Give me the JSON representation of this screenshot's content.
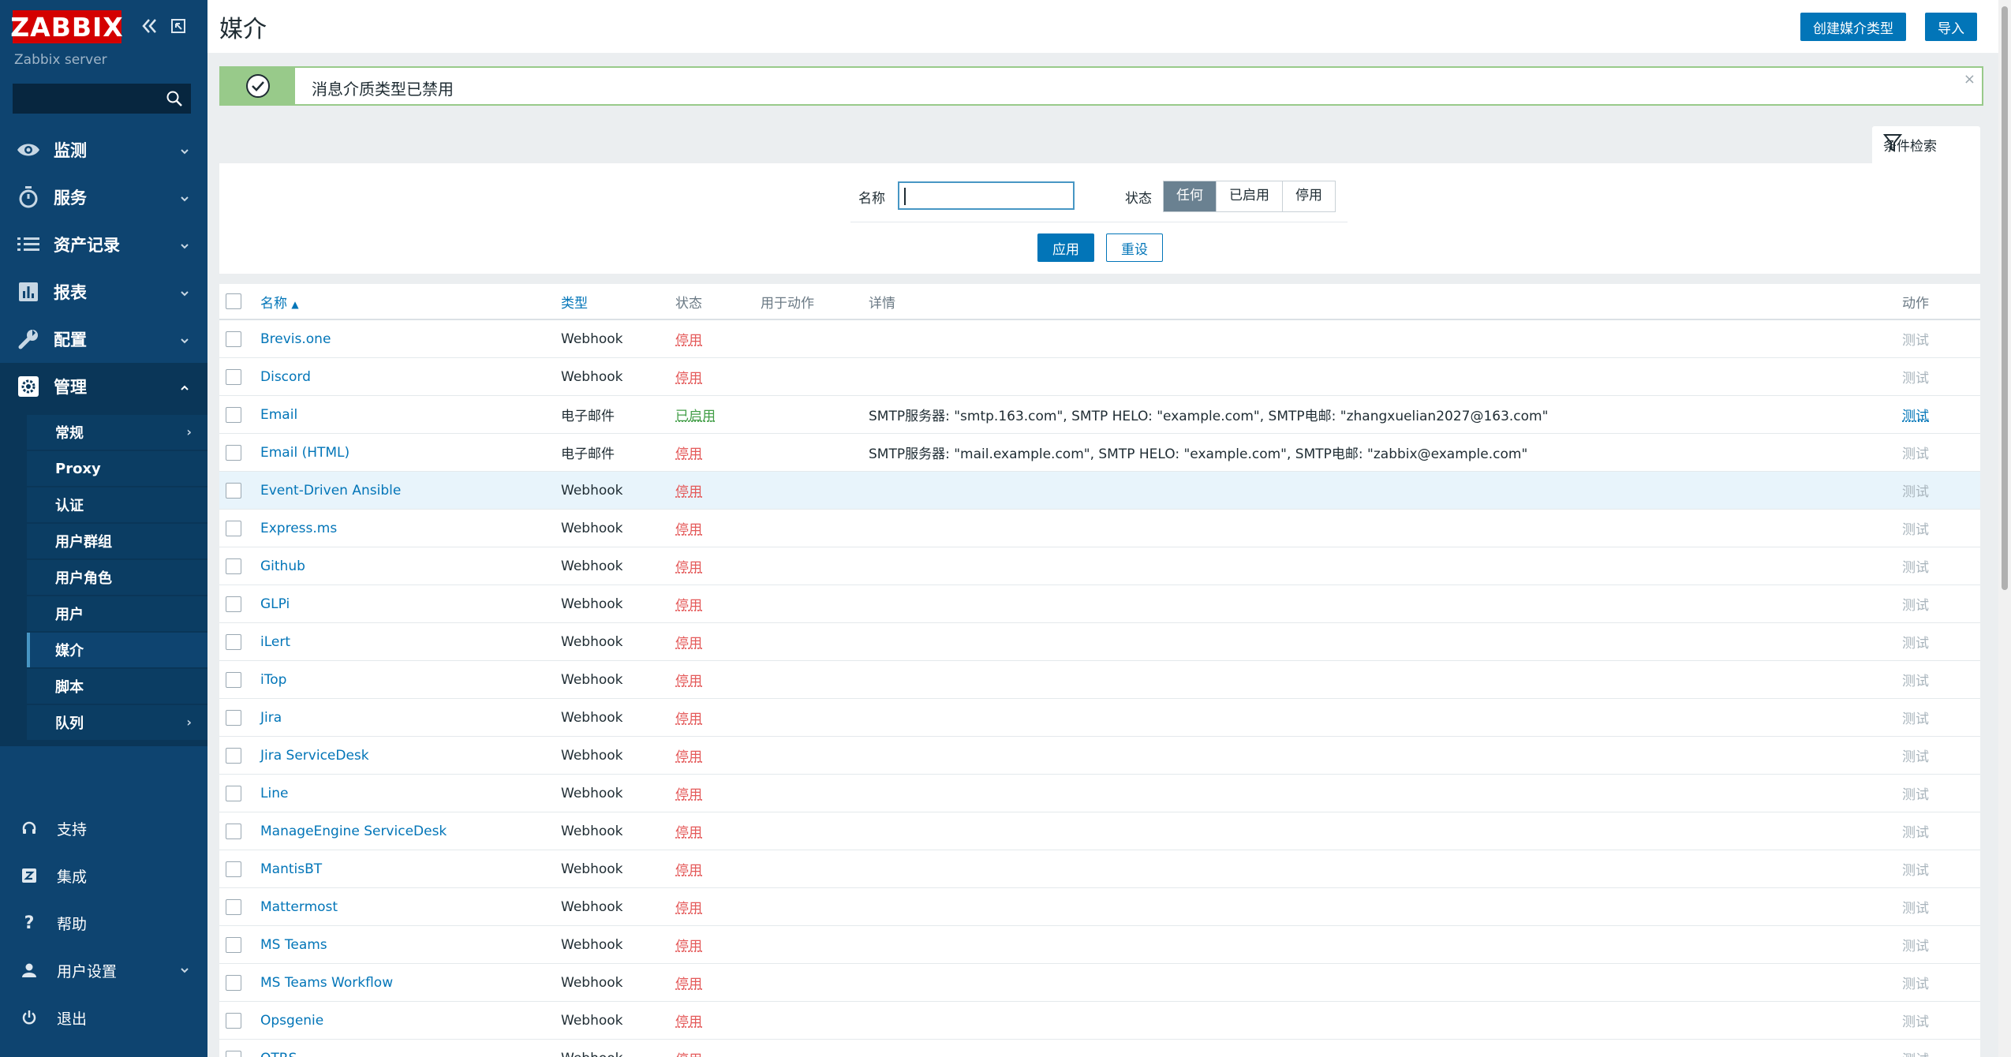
{
  "sidebar": {
    "logo": "ZABBIX",
    "server_name": "Zabbix server",
    "search_placeholder": "",
    "menu": [
      {
        "label": "监测",
        "icon": "eye-icon"
      },
      {
        "label": "服务",
        "icon": "stopwatch-icon"
      },
      {
        "label": "资产记录",
        "icon": "list-icon"
      },
      {
        "label": "报表",
        "icon": "bar-chart-icon"
      },
      {
        "label": "配置",
        "icon": "wrench-icon"
      },
      {
        "label": "管理",
        "icon": "gear-icon"
      }
    ],
    "submenu": [
      {
        "label": "常规"
      },
      {
        "label": "Proxy"
      },
      {
        "label": "认证"
      },
      {
        "label": "用户群组"
      },
      {
        "label": "用户角色"
      },
      {
        "label": "用户"
      },
      {
        "label": "媒介"
      },
      {
        "label": "脚本"
      },
      {
        "label": "队列"
      }
    ],
    "bottom": [
      {
        "label": "支持",
        "icon": "headset-icon"
      },
      {
        "label": "集成",
        "icon": "zabbix-z-icon"
      },
      {
        "label": "帮助",
        "icon": "question-icon"
      },
      {
        "label": "用户设置",
        "icon": "user-icon"
      },
      {
        "label": "退出",
        "icon": "power-icon"
      }
    ]
  },
  "header": {
    "title": "媒介",
    "create_button": "创建媒介类型",
    "import_button": "导入"
  },
  "message": {
    "text": "消息介质类型已禁用",
    "close": "×"
  },
  "filter": {
    "tab_label": "条件检索",
    "name_label": "名称",
    "name_value": "",
    "status_label": "状态",
    "status_options": [
      "任何",
      "已启用",
      "停用"
    ],
    "status_selected": "任何",
    "apply": "应用",
    "reset": "重设"
  },
  "table": {
    "columns": {
      "name": "名称",
      "sort_indicator": "▲",
      "type": "类型",
      "status": "状态",
      "used_in_actions": "用于动作",
      "details": "详情",
      "action": "动作"
    },
    "test_label": "测试",
    "rows": [
      {
        "name": "Brevis.one",
        "type": "Webhook",
        "status": "停用",
        "details": ""
      },
      {
        "name": "Discord",
        "type": "Webhook",
        "status": "停用",
        "details": ""
      },
      {
        "name": "Email",
        "type": "电子邮件",
        "status": "已启用",
        "details": "SMTP服务器: \"smtp.163.com\", SMTP HELO: \"example.com\", SMTP电邮: \"zhangxuelian2027@163.com\""
      },
      {
        "name": "Email (HTML)",
        "type": "电子邮件",
        "status": "停用",
        "details": "SMTP服务器: \"mail.example.com\", SMTP HELO: \"example.com\", SMTP电邮: \"zabbix@example.com\""
      },
      {
        "name": "Event-Driven Ansible",
        "type": "Webhook",
        "status": "停用",
        "details": ""
      },
      {
        "name": "Express.ms",
        "type": "Webhook",
        "status": "停用",
        "details": ""
      },
      {
        "name": "Github",
        "type": "Webhook",
        "status": "停用",
        "details": ""
      },
      {
        "name": "GLPi",
        "type": "Webhook",
        "status": "停用",
        "details": ""
      },
      {
        "name": "iLert",
        "type": "Webhook",
        "status": "停用",
        "details": ""
      },
      {
        "name": "iTop",
        "type": "Webhook",
        "status": "停用",
        "details": ""
      },
      {
        "name": "Jira",
        "type": "Webhook",
        "status": "停用",
        "details": ""
      },
      {
        "name": "Jira ServiceDesk",
        "type": "Webhook",
        "status": "停用",
        "details": ""
      },
      {
        "name": "Line",
        "type": "Webhook",
        "status": "停用",
        "details": ""
      },
      {
        "name": "ManageEngine ServiceDesk",
        "type": "Webhook",
        "status": "停用",
        "details": ""
      },
      {
        "name": "MantisBT",
        "type": "Webhook",
        "status": "停用",
        "details": ""
      },
      {
        "name": "Mattermost",
        "type": "Webhook",
        "status": "停用",
        "details": ""
      },
      {
        "name": "MS Teams",
        "type": "Webhook",
        "status": "停用",
        "details": ""
      },
      {
        "name": "MS Teams Workflow",
        "type": "Webhook",
        "status": "停用",
        "details": ""
      },
      {
        "name": "Opsgenie",
        "type": "Webhook",
        "status": "停用",
        "details": ""
      },
      {
        "name": "OTRS",
        "type": "Webhook",
        "status": "停用",
        "details": ""
      }
    ]
  },
  "colors": {
    "sidebar_bg": "#0e4470",
    "logo_red": "#d40000",
    "link_blue": "#0275b8",
    "status_disabled": "#e45959",
    "status_enabled": "#429e47",
    "success_green": "#98ca8a"
  }
}
